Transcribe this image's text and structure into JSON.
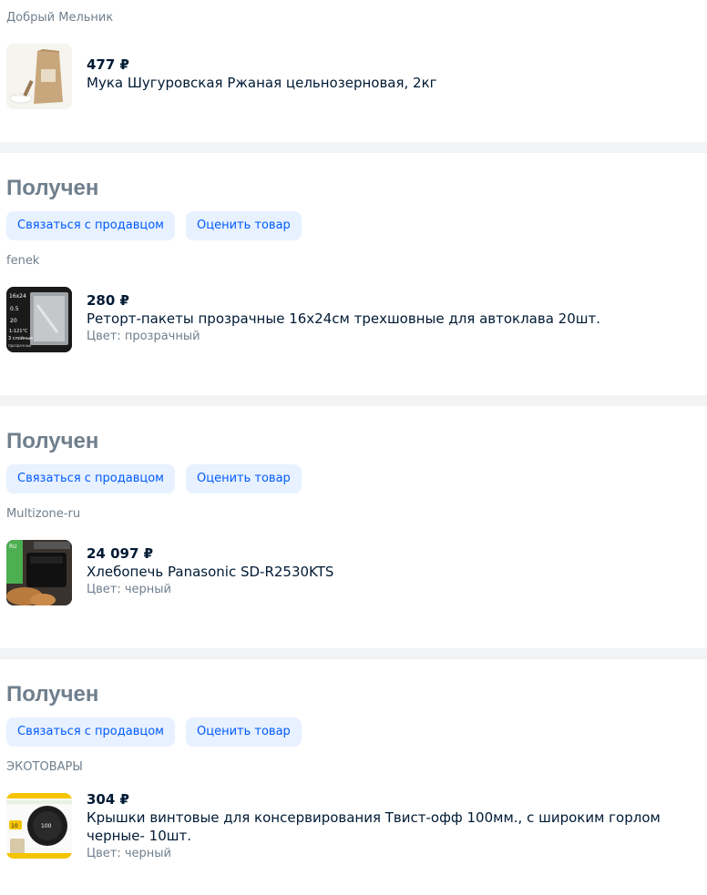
{
  "orders": [
    {
      "seller": "Добрый Мельник",
      "price": "477 ₽",
      "name": "Мука Шугуровская Ржаная цельнозерновая, 2кг",
      "attr": ""
    },
    {
      "status": "Получен",
      "contact_label": "Связаться с продавцом",
      "rate_label": "Оценить товар",
      "seller": "fenek",
      "price": "280 ₽",
      "name": "Реторт-пакеты прозрачные 16х24см трехшовные для автоклава 20шт.",
      "attr": "Цвет: прозрачный"
    },
    {
      "status": "Получен",
      "contact_label": "Связаться с продавцом",
      "rate_label": "Оценить товар",
      "seller": "Multizone-ru",
      "price": "24 097 ₽",
      "name": "Хлебопечь Panasonic SD-R2530KTS",
      "attr": "Цвет: черный"
    },
    {
      "status": "Получен",
      "contact_label": "Связаться с продавцом",
      "rate_label": "Оценить товар",
      "seller": "ЭКОТОВАРЫ",
      "price": "304 ₽",
      "name": "Крышки винтовые для консервирования Твист-офф 100мм., с широким горлом черные- 10шт.",
      "attr": "Цвет: черный"
    }
  ],
  "thumb_labels": {
    "bag_size": "16x24",
    "bag_thickness": "0.5",
    "bag_count": "20",
    "bag_temp": "1-121°C",
    "bag_layers": "3 слойные",
    "bag_caption": "прозрачные",
    "oven_badge": "RU",
    "lid_badge": "10",
    "lid_size": "100"
  },
  "colors": {
    "accent": "#005bff",
    "accent_bg": "#e8f1ff",
    "muted": "#707f8d",
    "separator": "#f2f3f5"
  }
}
